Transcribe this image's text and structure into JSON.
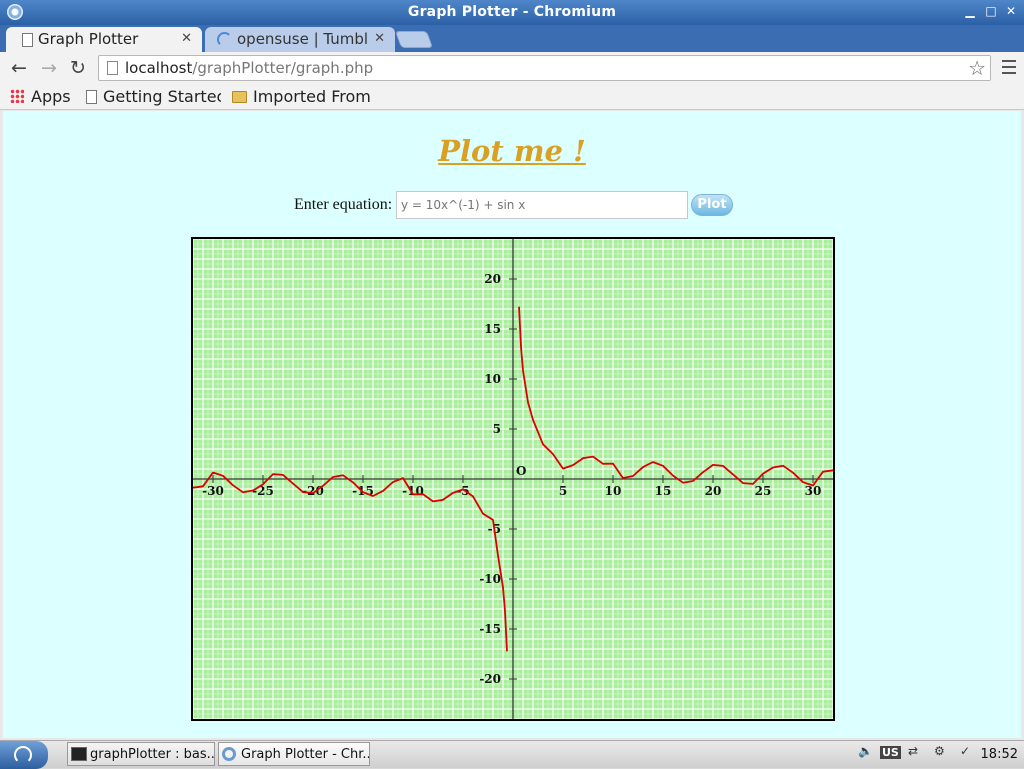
{
  "window": {
    "title": "Graph Plotter - Chromium"
  },
  "tabs": [
    {
      "label": "Graph Plotter",
      "active": true
    },
    {
      "label": "opensuse | Tumbl",
      "active": false
    }
  ],
  "toolbar": {
    "url_host": "localhost",
    "url_path": "/graphPlotter/graph.php"
  },
  "bookmarks": {
    "apps": "Apps",
    "getting_started": "Getting Startec",
    "imported_from": "Imported From"
  },
  "page": {
    "heading": "Plot me !",
    "equation_label": "Enter equation:",
    "equation_placeholder": "y = 10x^(-1) + sin x",
    "plot_button": "Plot"
  },
  "chart_data": {
    "type": "line",
    "title": "",
    "xlabel": "",
    "ylabel": "",
    "xlim": [
      -32,
      32
    ],
    "ylim": [
      -24,
      24
    ],
    "grid": true,
    "origin_label": "O",
    "x_ticks": [
      -30,
      -25,
      -20,
      -15,
      -10,
      -5,
      5,
      10,
      15,
      20,
      25,
      30
    ],
    "y_ticks": [
      20,
      15,
      10,
      5,
      -5,
      -10,
      -15,
      -20
    ],
    "series": [
      {
        "color": "#dd0000",
        "x": [
          -32,
          -31,
          -30,
          -29,
          -28,
          -27,
          -26,
          -25,
          -24,
          -23,
          -22,
          -21,
          -20,
          -19,
          -18,
          -17,
          -16,
          -15,
          -14,
          -13,
          -12,
          -11,
          -10,
          -9,
          -8,
          -7,
          -6,
          -5,
          -4,
          -3,
          -2,
          -1.5,
          -1,
          -0.8,
          -0.6,
          0.6,
          0.8,
          1,
          1.5,
          2,
          3,
          4,
          5,
          6,
          7,
          8,
          9,
          10,
          11,
          12,
          13,
          14,
          15,
          16,
          17,
          18,
          19,
          20,
          21,
          22,
          23,
          24,
          25,
          26,
          27,
          28,
          29,
          30,
          31,
          32
        ],
        "y": [
          -0.87,
          -0.73,
          0.65,
          0.32,
          -0.63,
          -1.33,
          -1.15,
          -0.53,
          0.49,
          0.41,
          -0.46,
          -1.31,
          -1.41,
          -0.68,
          0.2,
          0.37,
          -0.34,
          -1.32,
          -1.7,
          -1.19,
          -0.3,
          0.09,
          -1.54,
          -1.52,
          -2.24,
          -2.08,
          -1.39,
          -1.04,
          -1.74,
          -3.47,
          -4.09,
          -7.66,
          -10.84,
          -13.22,
          -17.23,
          17.23,
          13.22,
          10.84,
          7.66,
          5.91,
          3.47,
          2.49,
          1.04,
          1.39,
          2.08,
          2.24,
          1.52,
          1.54,
          0.09,
          0.3,
          1.19,
          1.7,
          1.32,
          0.34,
          -0.37,
          -0.2,
          0.68,
          1.41,
          1.31,
          0.46,
          -0.41,
          -0.49,
          0.53,
          1.15,
          1.33,
          0.63,
          -0.32,
          -0.65,
          0.73,
          0.87
        ]
      }
    ]
  },
  "taskbar": {
    "items": [
      {
        "label": "graphPlotter : bas..."
      },
      {
        "label": "Graph Plotter - Chr..."
      }
    ],
    "keyboard_layout": "US",
    "clock": "18:52"
  }
}
